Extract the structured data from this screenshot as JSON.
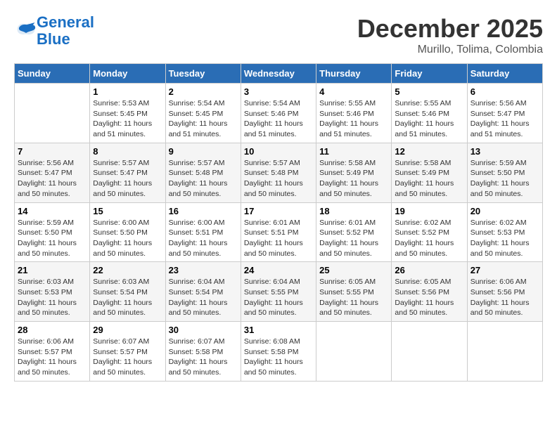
{
  "header": {
    "logo_line1": "General",
    "logo_line2": "Blue",
    "month": "December 2025",
    "location": "Murillo, Tolima, Colombia"
  },
  "weekdays": [
    "Sunday",
    "Monday",
    "Tuesday",
    "Wednesday",
    "Thursday",
    "Friday",
    "Saturday"
  ],
  "weeks": [
    [
      {
        "day": "",
        "info": ""
      },
      {
        "day": "1",
        "info": "Sunrise: 5:53 AM\nSunset: 5:45 PM\nDaylight: 11 hours and 51 minutes."
      },
      {
        "day": "2",
        "info": "Sunrise: 5:54 AM\nSunset: 5:45 PM\nDaylight: 11 hours and 51 minutes."
      },
      {
        "day": "3",
        "info": "Sunrise: 5:54 AM\nSunset: 5:46 PM\nDaylight: 11 hours and 51 minutes."
      },
      {
        "day": "4",
        "info": "Sunrise: 5:55 AM\nSunset: 5:46 PM\nDaylight: 11 hours and 51 minutes."
      },
      {
        "day": "5",
        "info": "Sunrise: 5:55 AM\nSunset: 5:46 PM\nDaylight: 11 hours and 51 minutes."
      },
      {
        "day": "6",
        "info": "Sunrise: 5:56 AM\nSunset: 5:47 PM\nDaylight: 11 hours and 51 minutes."
      }
    ],
    [
      {
        "day": "7",
        "info": "Sunrise: 5:56 AM\nSunset: 5:47 PM\nDaylight: 11 hours and 50 minutes."
      },
      {
        "day": "8",
        "info": "Sunrise: 5:57 AM\nSunset: 5:47 PM\nDaylight: 11 hours and 50 minutes."
      },
      {
        "day": "9",
        "info": "Sunrise: 5:57 AM\nSunset: 5:48 PM\nDaylight: 11 hours and 50 minutes."
      },
      {
        "day": "10",
        "info": "Sunrise: 5:57 AM\nSunset: 5:48 PM\nDaylight: 11 hours and 50 minutes."
      },
      {
        "day": "11",
        "info": "Sunrise: 5:58 AM\nSunset: 5:49 PM\nDaylight: 11 hours and 50 minutes."
      },
      {
        "day": "12",
        "info": "Sunrise: 5:58 AM\nSunset: 5:49 PM\nDaylight: 11 hours and 50 minutes."
      },
      {
        "day": "13",
        "info": "Sunrise: 5:59 AM\nSunset: 5:50 PM\nDaylight: 11 hours and 50 minutes."
      }
    ],
    [
      {
        "day": "14",
        "info": "Sunrise: 5:59 AM\nSunset: 5:50 PM\nDaylight: 11 hours and 50 minutes."
      },
      {
        "day": "15",
        "info": "Sunrise: 6:00 AM\nSunset: 5:50 PM\nDaylight: 11 hours and 50 minutes."
      },
      {
        "day": "16",
        "info": "Sunrise: 6:00 AM\nSunset: 5:51 PM\nDaylight: 11 hours and 50 minutes."
      },
      {
        "day": "17",
        "info": "Sunrise: 6:01 AM\nSunset: 5:51 PM\nDaylight: 11 hours and 50 minutes."
      },
      {
        "day": "18",
        "info": "Sunrise: 6:01 AM\nSunset: 5:52 PM\nDaylight: 11 hours and 50 minutes."
      },
      {
        "day": "19",
        "info": "Sunrise: 6:02 AM\nSunset: 5:52 PM\nDaylight: 11 hours and 50 minutes."
      },
      {
        "day": "20",
        "info": "Sunrise: 6:02 AM\nSunset: 5:53 PM\nDaylight: 11 hours and 50 minutes."
      }
    ],
    [
      {
        "day": "21",
        "info": "Sunrise: 6:03 AM\nSunset: 5:53 PM\nDaylight: 11 hours and 50 minutes."
      },
      {
        "day": "22",
        "info": "Sunrise: 6:03 AM\nSunset: 5:54 PM\nDaylight: 11 hours and 50 minutes."
      },
      {
        "day": "23",
        "info": "Sunrise: 6:04 AM\nSunset: 5:54 PM\nDaylight: 11 hours and 50 minutes."
      },
      {
        "day": "24",
        "info": "Sunrise: 6:04 AM\nSunset: 5:55 PM\nDaylight: 11 hours and 50 minutes."
      },
      {
        "day": "25",
        "info": "Sunrise: 6:05 AM\nSunset: 5:55 PM\nDaylight: 11 hours and 50 minutes."
      },
      {
        "day": "26",
        "info": "Sunrise: 6:05 AM\nSunset: 5:56 PM\nDaylight: 11 hours and 50 minutes."
      },
      {
        "day": "27",
        "info": "Sunrise: 6:06 AM\nSunset: 5:56 PM\nDaylight: 11 hours and 50 minutes."
      }
    ],
    [
      {
        "day": "28",
        "info": "Sunrise: 6:06 AM\nSunset: 5:57 PM\nDaylight: 11 hours and 50 minutes."
      },
      {
        "day": "29",
        "info": "Sunrise: 6:07 AM\nSunset: 5:57 PM\nDaylight: 11 hours and 50 minutes."
      },
      {
        "day": "30",
        "info": "Sunrise: 6:07 AM\nSunset: 5:58 PM\nDaylight: 11 hours and 50 minutes."
      },
      {
        "day": "31",
        "info": "Sunrise: 6:08 AM\nSunset: 5:58 PM\nDaylight: 11 hours and 50 minutes."
      },
      {
        "day": "",
        "info": ""
      },
      {
        "day": "",
        "info": ""
      },
      {
        "day": "",
        "info": ""
      }
    ]
  ]
}
